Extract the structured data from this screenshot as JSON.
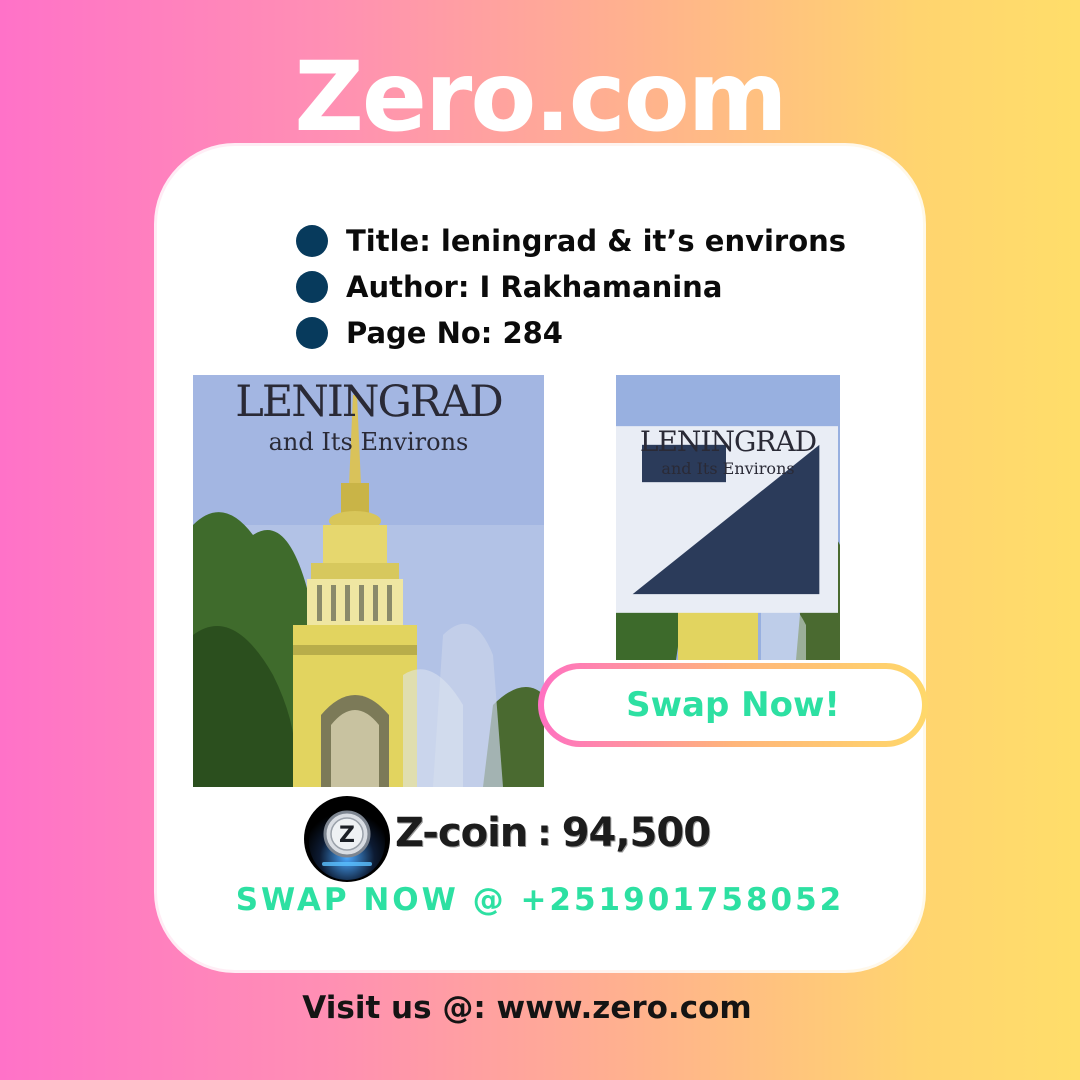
{
  "brand": {
    "name": "Zero.com"
  },
  "book": {
    "title_line": "Title: leningrad & it’s environs",
    "author_line": "Author: I Rakhamanina",
    "pages_line": "Page No:  284"
  },
  "covers": [
    {
      "title": "LENINGRAD",
      "subtitle": "and Its Environs"
    },
    {
      "title": "LENINGRAD",
      "subtitle": "and Its Environs"
    }
  ],
  "actions": {
    "swap_button_label": "Swap Now!"
  },
  "price": {
    "currency_label": "Z-coin",
    "separator": ":",
    "amount": "94,500",
    "coin_glyph": "Z"
  },
  "contact": {
    "swap_line": "SWAP NOW @ +251901758052"
  },
  "footer": {
    "visit_line": "Visit us @: www.zero.com"
  },
  "colors": {
    "accent_green": "#2de0a2",
    "bullet_navy": "#073a5c",
    "gradient_left": "#ff72c8",
    "gradient_right": "#ffde6a"
  },
  "icons": {
    "bullet": "bullet-dot-icon",
    "coin": "z-coin-icon",
    "publisher": "publisher-logo-icon"
  }
}
